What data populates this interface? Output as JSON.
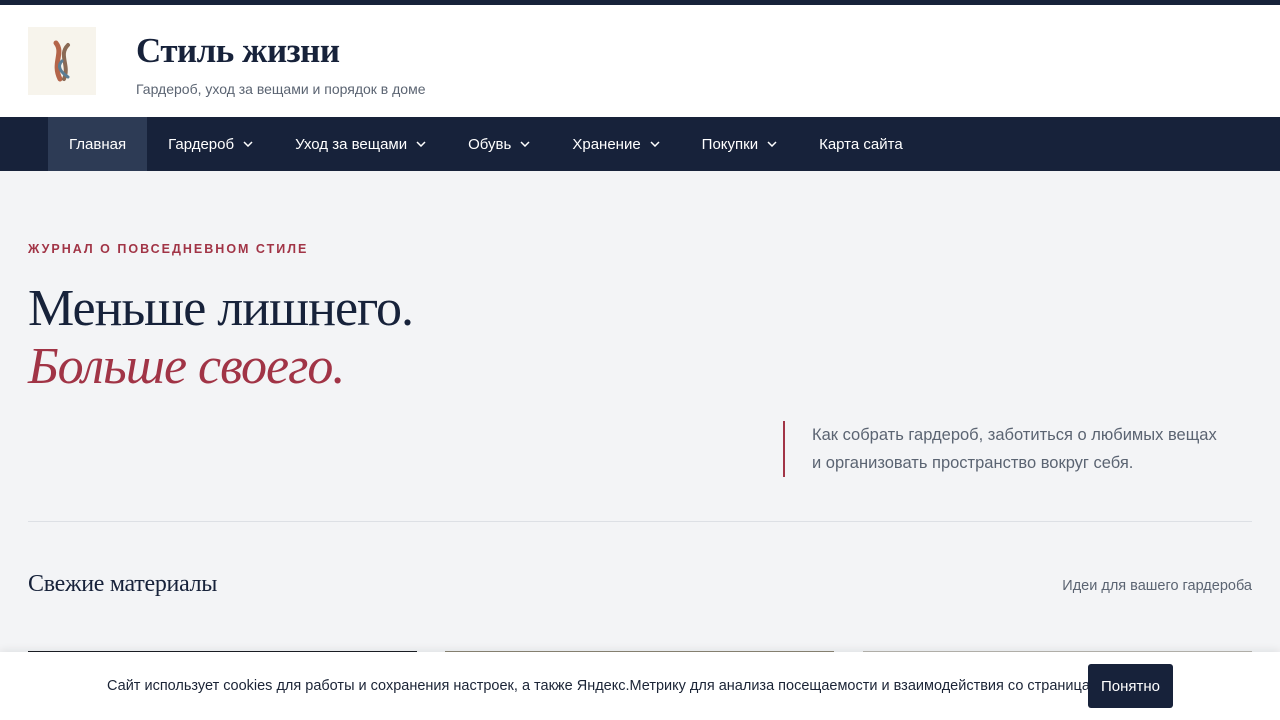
{
  "header": {
    "title": "Стиль жизни",
    "tagline": "Гардероб, уход за вещами и порядок в доме"
  },
  "nav": {
    "items": [
      {
        "label": "Главная",
        "active": true,
        "has_dropdown": false
      },
      {
        "label": "Гардероб",
        "active": false,
        "has_dropdown": true
      },
      {
        "label": "Уход за вещами",
        "active": false,
        "has_dropdown": true
      },
      {
        "label": "Обувь",
        "active": false,
        "has_dropdown": true
      },
      {
        "label": "Хранение",
        "active": false,
        "has_dropdown": true
      },
      {
        "label": "Покупки",
        "active": false,
        "has_dropdown": true
      },
      {
        "label": "Карта сайта",
        "active": false,
        "has_dropdown": false
      }
    ]
  },
  "hero": {
    "eyebrow": "ЖУРНАЛ О ПОВСЕДНЕВНОМ СТИЛЕ",
    "headline_line1": "Меньше лишнего.",
    "headline_line2": "Больше своего.",
    "lead_line1": "Как собрать гардероб, заботиться о любимых вещах",
    "lead_line2": "и организовать пространство вокруг себя."
  },
  "section": {
    "title": "Свежие материалы",
    "link": "Идеи для вашего гардероба"
  },
  "cookie": {
    "text": "Сайт использует cookies для работы и сохранения настроек, а также Яндекс.Метрику для анализа посещаемости и взаимодействия со страницами.",
    "button_label": "Понятно"
  },
  "colors": {
    "navy": "#17223a",
    "accent": "#a13446",
    "muted": "#5b6472",
    "background": "#f3f4f6"
  },
  "icons": {
    "logo": "ribbon-logo-icon",
    "dropdown": "chevron-down-icon"
  }
}
